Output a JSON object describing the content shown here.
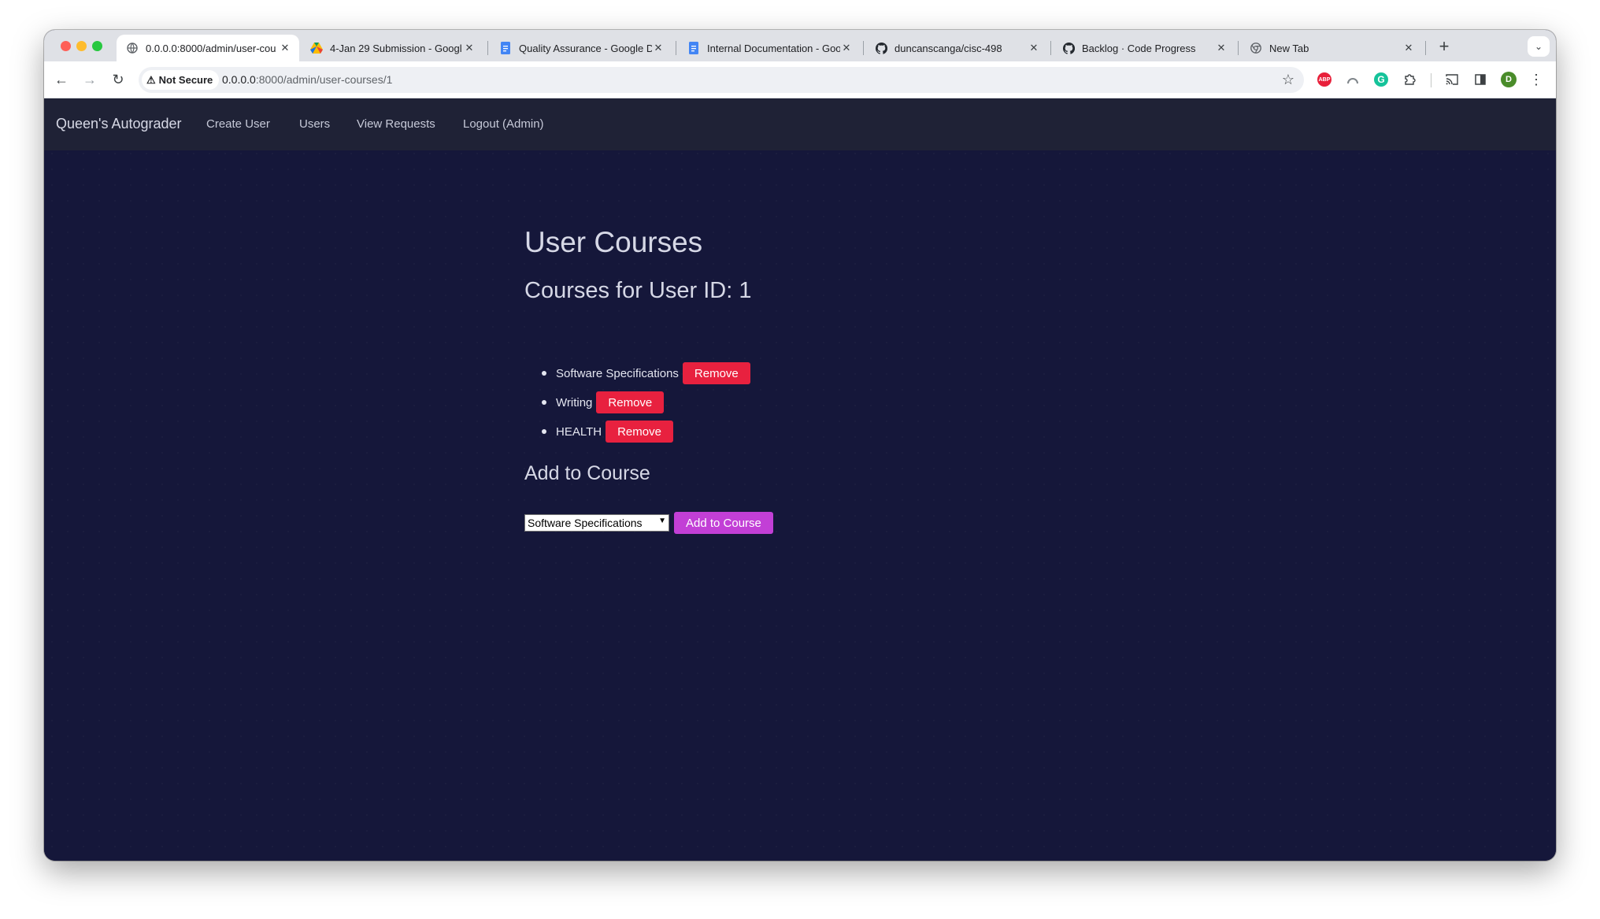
{
  "browser": {
    "tabs": [
      {
        "title": "0.0.0.0:8000/admin/user-cou",
        "icon": "globe-icon",
        "active": true
      },
      {
        "title": "4-Jan 29 Submission - Googl",
        "icon": "google-drive-icon",
        "active": false
      },
      {
        "title": "Quality Assurance - Google D",
        "icon": "google-docs-icon",
        "active": false
      },
      {
        "title": "Internal Documentation - Goo",
        "icon": "google-docs-icon",
        "active": false
      },
      {
        "title": "duncanscanga/cisc-498",
        "icon": "github-icon",
        "active": false
      },
      {
        "title": "Backlog · Code Progress",
        "icon": "github-icon",
        "active": false
      },
      {
        "title": "New Tab",
        "icon": "chrome-icon",
        "active": false
      }
    ],
    "security_label": "Not Secure",
    "url_host": "0.0.0.0",
    "url_path": ":8000/admin/user-courses/1",
    "profile_initial": "D",
    "abp_label": "ABP",
    "grammarly_label": "G"
  },
  "nav": {
    "brand": "Queen's Autograder",
    "links": [
      "Create User",
      "Users",
      "View Requests",
      "Logout (Admin)"
    ]
  },
  "page": {
    "title": "User Courses",
    "subtitle": "Courses for User ID: 1",
    "courses": [
      {
        "name": "Software Specifications",
        "action": "Remove"
      },
      {
        "name": "Writing",
        "action": "Remove"
      },
      {
        "name": "HEALTH",
        "action": "Remove"
      }
    ],
    "add_heading": "Add to Course",
    "select_value": "Software Specifications",
    "add_button": "Add to Course"
  },
  "colors": {
    "page_bg": "#15173a",
    "navbar_bg": "#1f2236",
    "remove_button": "#e8213f",
    "add_button": "#c23fd6"
  }
}
